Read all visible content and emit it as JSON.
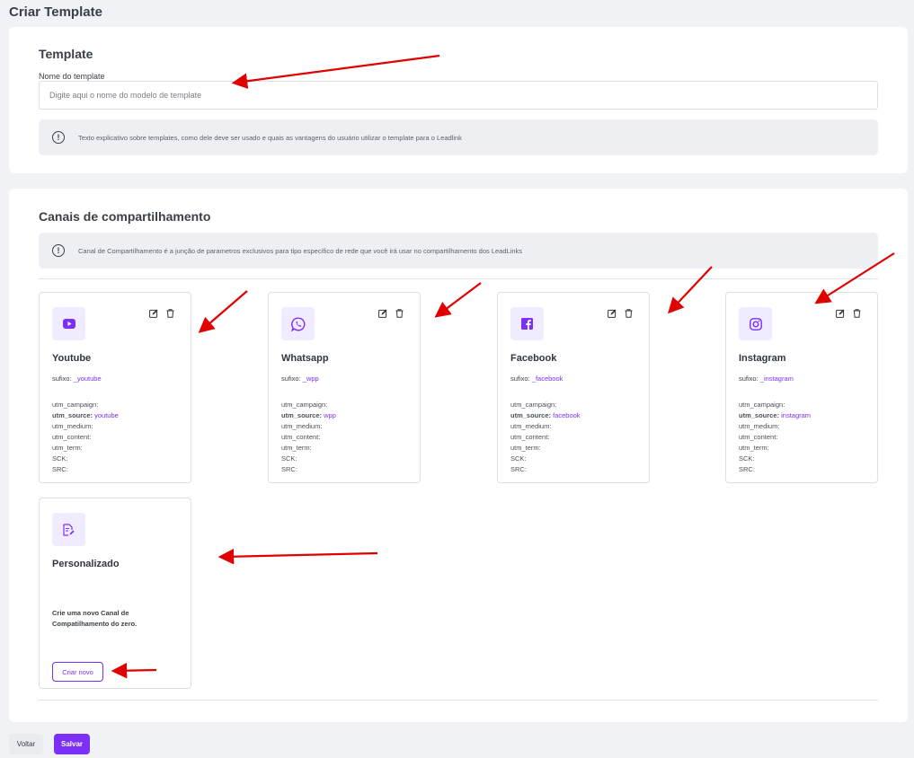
{
  "page": {
    "title": "Criar Template"
  },
  "template_section": {
    "title": "Template",
    "name_label": "Nome do template",
    "name_placeholder": "Digite aqui o nome do modelo de template",
    "name_value": "",
    "info_text": "Texto explicativo sobre templates, como dele deve ser usado e quais as vantagens do usuário utilizar o template para o Leadlink"
  },
  "channels_section": {
    "title": "Canais de compartilhamento",
    "info_text": "Canal de Compartilhamento é a junção de parametros exclusivos para tipo específico de rede que você irá usar no compartilhamento dos LeadLinks",
    "cards": [
      {
        "name": "Youtube",
        "icon": "youtube-icon",
        "suffix_label": "sufixo:",
        "suffix": "_youtube",
        "utm_campaign": "utm_campaign:",
        "utm_source": "utm_source:",
        "utm_source_value": "youtube",
        "utm_medium": "utm_medium:",
        "utm_content": "utm_content:",
        "utm_term": "utm_term:",
        "sck": "SCK:",
        "src": "SRC:"
      },
      {
        "name": "Whatsapp",
        "icon": "whatsapp-icon",
        "suffix_label": "sufixo:",
        "suffix": "_wpp",
        "utm_campaign": "utm_campaign:",
        "utm_source": "utm_source:",
        "utm_source_value": "wpp",
        "utm_medium": "utm_medium:",
        "utm_content": "utm_content:",
        "utm_term": "utm_term:",
        "sck": "SCK:",
        "src": "SRC:"
      },
      {
        "name": "Facebook",
        "icon": "facebook-icon",
        "suffix_label": "sufixo:",
        "suffix": "_facebook",
        "utm_campaign": "utm_campaign:",
        "utm_source": "utm_source:",
        "utm_source_value": "facebook",
        "utm_medium": "utm_medium:",
        "utm_content": "utm_content:",
        "utm_term": "utm_term:",
        "sck": "SCK:",
        "src": "SRC:"
      },
      {
        "name": "Instagram",
        "icon": "instagram-icon",
        "suffix_label": "sufixo:",
        "suffix": "_instagram",
        "utm_campaign": "utm_campaign:",
        "utm_source": "utm_source:",
        "utm_source_value": "instagram",
        "utm_medium": "utm_medium:",
        "utm_content": "utm_content:",
        "utm_term": "utm_term:",
        "sck": "SCK:",
        "src": "SRC:"
      }
    ],
    "custom_card": {
      "name": "Personalizado",
      "icon": "document-edit-icon",
      "description": "Crie uma novo Canal de Compatilhamento do zero.",
      "button_label": "Criar novo"
    }
  },
  "footer": {
    "back_label": "Voltar",
    "save_label": "Salvar"
  },
  "colors": {
    "accent": "#7b2ff7",
    "icon_bg": "#f1ebff",
    "arrow": "#e00000"
  }
}
